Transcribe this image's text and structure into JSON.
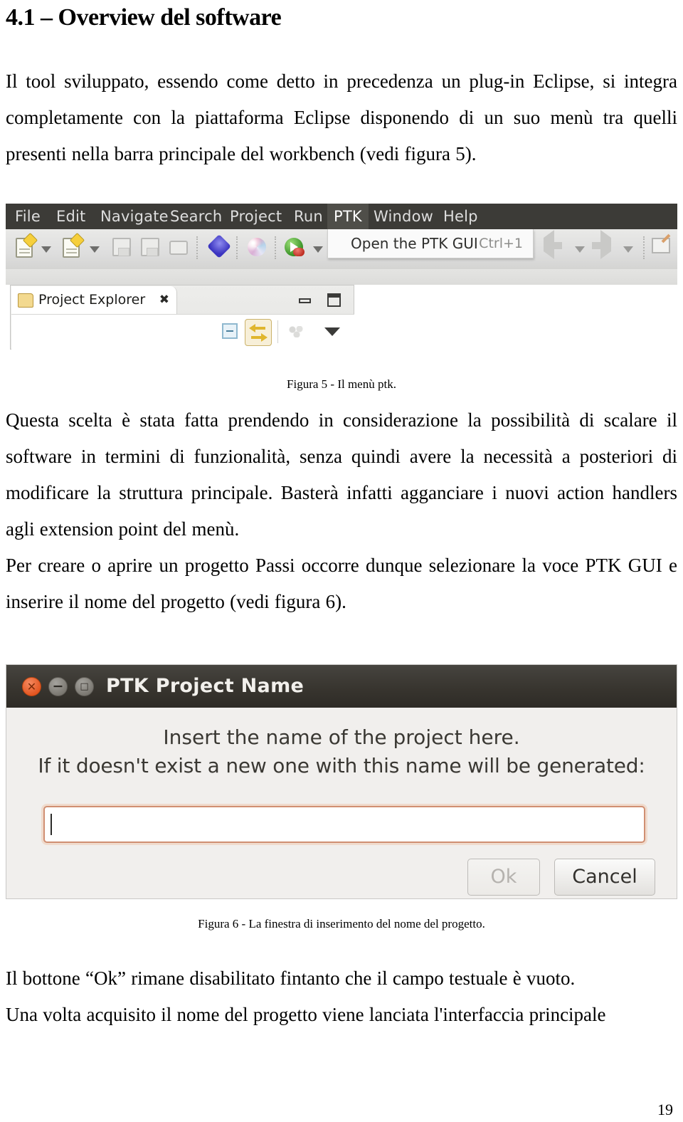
{
  "document": {
    "heading": "4.1 – Overview del software",
    "paragraph_1": "Il tool sviluppato, essendo come detto in precedenza un plug-in Eclipse, si integra completamente con la piattaforma Eclipse disponendo di un suo menù tra quelli presenti nella barra principale del workbench (vedi figura 5).",
    "figure_5_caption": "Figura 5 - Il menù ptk.",
    "paragraph_2": "Questa scelta è stata fatta prendendo in considerazione la possibilità di scalare il software in termini di funzionalità, senza quindi avere la necessità a posteriori di modificare la struttura principale. Basterà infatti agganciare i nuovi action handlers agli extension point del menù.",
    "paragraph_3": "Per creare o aprire un progetto Passi occorre dunque selezionare la voce PTK GUI e inserire il nome del progetto (vedi figura 6).",
    "figure_6_caption": "Figura 6 - La finestra di inserimento del nome del progetto.",
    "paragraph_4": "Il bottone “Ok” rimane disabilitato fintanto che il campo testuale è vuoto.",
    "paragraph_5": "Una volta acquisito il nome del progetto viene lanciata l'interfaccia principale",
    "page_number": "19"
  },
  "figure5": {
    "menubar": {
      "items": [
        {
          "label": "File",
          "active": false
        },
        {
          "label": "Edit",
          "active": false
        },
        {
          "label": "Navigate",
          "active": false
        },
        {
          "label": "Search",
          "active": false
        },
        {
          "label": "Project",
          "active": false
        },
        {
          "label": "Run",
          "active": false
        },
        {
          "label": "PTK",
          "active": true
        },
        {
          "label": "Window",
          "active": false
        },
        {
          "label": "Help",
          "active": false
        }
      ],
      "background_color": "#3c3b37",
      "active_background_color": "#4f4e49"
    },
    "menu_popup": {
      "item_label": "Open the PTK GUI",
      "item_accelerator": "Ctrl+1"
    },
    "view": {
      "tab_title": "Project Explorer",
      "tab_close_glyph": "✖",
      "minimize_tooltip": "Minimize",
      "maximize_tooltip": "Maximize"
    }
  },
  "figure6": {
    "title": "PTK Project Name",
    "window_buttons": {
      "close_glyph": "✕",
      "minimize_glyph": "−",
      "maximize_glyph": "□",
      "close_color": "#e2541f"
    },
    "message_line_1": "Insert the name of the project here.",
    "message_line_2": "If it doesn't exist a new one with this name will be generated:",
    "input_value": "",
    "input_focus_color": "#d08f72",
    "ok_label": "Ok",
    "cancel_label": "Cancel"
  }
}
